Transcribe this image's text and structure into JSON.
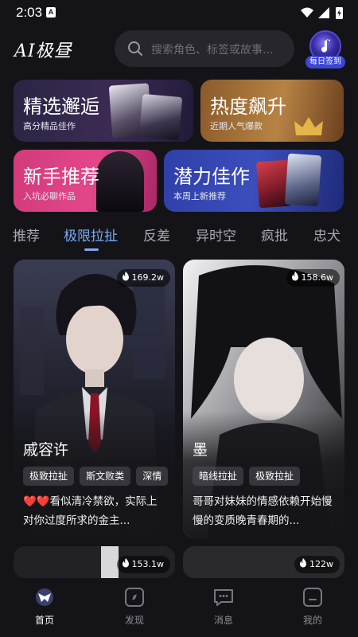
{
  "status_bar": {
    "time": "2:03",
    "app_indicator": "A",
    "icons": [
      "wifi-icon",
      "signal-icon",
      "battery-charging-icon"
    ]
  },
  "header": {
    "logo_text": "AI极昼",
    "search_placeholder": "搜索角色、标签或故事...",
    "checkin_label": "每日签到"
  },
  "categories": [
    {
      "title": "精选邂逅",
      "subtitle": "高分精品佳作"
    },
    {
      "title": "热度飙升",
      "subtitle": "近期人气爆款"
    },
    {
      "title": "新手推荐",
      "subtitle": "入坑必聊作品"
    },
    {
      "title": "潜力佳作",
      "subtitle": "本周上新推荐"
    }
  ],
  "tabs": [
    "推荐",
    "极限拉扯",
    "反差",
    "异时空",
    "疯批",
    "忠犬"
  ],
  "active_tab": "极限拉扯",
  "feed": [
    {
      "name": "戚容许",
      "views": "169.2w",
      "tags": [
        "极致拉扯",
        "斯文败类",
        "深情"
      ],
      "description": "❤️❤️看似清冷禁欲，实际上对你过度所求的金主..."
    },
    {
      "name": "墨",
      "views": "158.6w",
      "tags": [
        "暗线拉扯",
        "极致拉扯"
      ],
      "description": "哥哥对妹妹的情感依赖开始慢慢的变质晚青春期的..."
    },
    {
      "views": "153.1w"
    },
    {
      "views": "122w"
    }
  ],
  "bottom_nav": [
    {
      "label": "首页",
      "icon": "home-icon",
      "active": true
    },
    {
      "label": "发现",
      "icon": "discover-icon",
      "active": false
    },
    {
      "label": "消息",
      "icon": "message-icon",
      "active": false
    },
    {
      "label": "我的",
      "icon": "profile-icon",
      "active": false
    }
  ],
  "colors": {
    "accent": "#79aaf5",
    "background": "#141418",
    "checkin_badge": "#3d46d4"
  }
}
